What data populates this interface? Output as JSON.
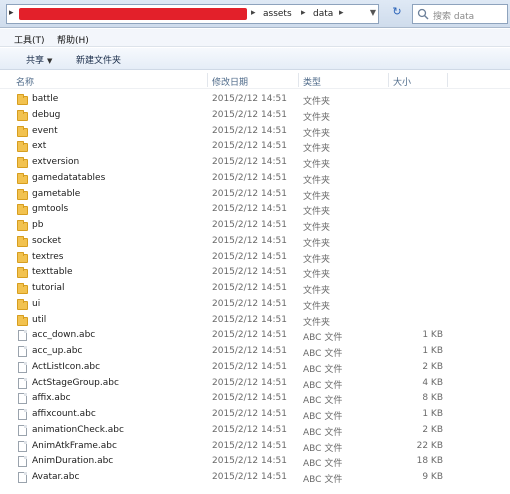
{
  "address_bar": {
    "path": [
      "assets",
      "data"
    ],
    "search_placeholder": "搜索 data"
  },
  "menu": {
    "items": [
      "工具(T)",
      "帮助(H)"
    ]
  },
  "toolbar": {
    "share_label": "共享",
    "new_folder_label": "新建文件夹"
  },
  "columns": {
    "name": "名称",
    "date": "修改日期",
    "type": "类型",
    "size": "大小"
  },
  "files": [
    {
      "name": "battle",
      "date": "2015/2/12 14:51",
      "type": "文件夹",
      "size": "",
      "kind": "folder"
    },
    {
      "name": "debug",
      "date": "2015/2/12 14:51",
      "type": "文件夹",
      "size": "",
      "kind": "folder"
    },
    {
      "name": "event",
      "date": "2015/2/12 14:51",
      "type": "文件夹",
      "size": "",
      "kind": "folder"
    },
    {
      "name": "ext",
      "date": "2015/2/12 14:51",
      "type": "文件夹",
      "size": "",
      "kind": "folder"
    },
    {
      "name": "extversion",
      "date": "2015/2/12 14:51",
      "type": "文件夹",
      "size": "",
      "kind": "folder"
    },
    {
      "name": "gamedatatables",
      "date": "2015/2/12 14:51",
      "type": "文件夹",
      "size": "",
      "kind": "folder"
    },
    {
      "name": "gametable",
      "date": "2015/2/12 14:51",
      "type": "文件夹",
      "size": "",
      "kind": "folder"
    },
    {
      "name": "gmtools",
      "date": "2015/2/12 14:51",
      "type": "文件夹",
      "size": "",
      "kind": "folder"
    },
    {
      "name": "pb",
      "date": "2015/2/12 14:51",
      "type": "文件夹",
      "size": "",
      "kind": "folder"
    },
    {
      "name": "socket",
      "date": "2015/2/12 14:51",
      "type": "文件夹",
      "size": "",
      "kind": "folder"
    },
    {
      "name": "textres",
      "date": "2015/2/12 14:51",
      "type": "文件夹",
      "size": "",
      "kind": "folder"
    },
    {
      "name": "texttable",
      "date": "2015/2/12 14:51",
      "type": "文件夹",
      "size": "",
      "kind": "folder"
    },
    {
      "name": "tutorial",
      "date": "2015/2/12 14:51",
      "type": "文件夹",
      "size": "",
      "kind": "folder"
    },
    {
      "name": "ui",
      "date": "2015/2/12 14:51",
      "type": "文件夹",
      "size": "",
      "kind": "folder"
    },
    {
      "name": "util",
      "date": "2015/2/12 14:51",
      "type": "文件夹",
      "size": "",
      "kind": "folder"
    },
    {
      "name": "acc_down.abc",
      "date": "2015/2/12 14:51",
      "type": "ABC 文件",
      "size": "1 KB",
      "kind": "file"
    },
    {
      "name": "acc_up.abc",
      "date": "2015/2/12 14:51",
      "type": "ABC 文件",
      "size": "1 KB",
      "kind": "file"
    },
    {
      "name": "ActListIcon.abc",
      "date": "2015/2/12 14:51",
      "type": "ABC 文件",
      "size": "2 KB",
      "kind": "file"
    },
    {
      "name": "ActStageGroup.abc",
      "date": "2015/2/12 14:51",
      "type": "ABC 文件",
      "size": "4 KB",
      "kind": "file"
    },
    {
      "name": "affix.abc",
      "date": "2015/2/12 14:51",
      "type": "ABC 文件",
      "size": "8 KB",
      "kind": "file"
    },
    {
      "name": "affixcount.abc",
      "date": "2015/2/12 14:51",
      "type": "ABC 文件",
      "size": "1 KB",
      "kind": "file"
    },
    {
      "name": "animationCheck.abc",
      "date": "2015/2/12 14:51",
      "type": "ABC 文件",
      "size": "2 KB",
      "kind": "file"
    },
    {
      "name": "AnimAtkFrame.abc",
      "date": "2015/2/12 14:51",
      "type": "ABC 文件",
      "size": "22 KB",
      "kind": "file"
    },
    {
      "name": "AnimDuration.abc",
      "date": "2015/2/12 14:51",
      "type": "ABC 文件",
      "size": "18 KB",
      "kind": "file"
    },
    {
      "name": "Avatar.abc",
      "date": "2015/2/12 14:51",
      "type": "ABC 文件",
      "size": "9 KB",
      "kind": "file"
    }
  ]
}
